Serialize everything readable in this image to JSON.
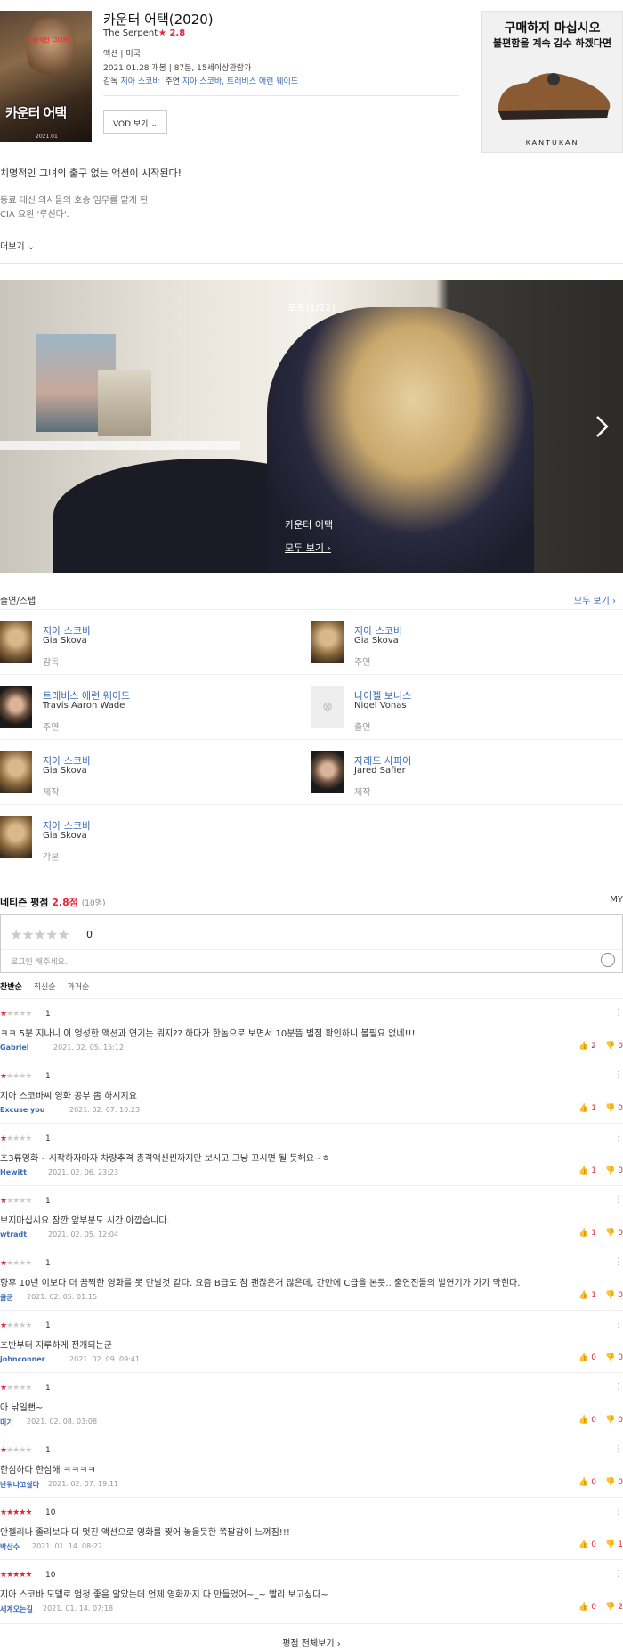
{
  "movie": {
    "title": "카운터 어택(2020)",
    "subtitle": "The Serpent",
    "rating": "★ 2.8",
    "genre": "액션  |  미국",
    "release": "2021.01.28 개봉  |  87분, 15세이상관람가",
    "director_label": "감독",
    "director": "지아 스코바",
    "cast_label": "주연",
    "cast": "지아 스코바, 트래비스 애런 웨이드",
    "vod_button": "VOD 보기",
    "poster_title": "카운터 어택",
    "poster_tag": "치명적인 그녀의",
    "poster_date": "2021.01"
  },
  "ad": {
    "line1": "구매하지 마십시오",
    "line2": "불편함을 계속 감수 하겠다면",
    "brand": "KANTUKAN"
  },
  "synopsis": {
    "tagline": "치명적인 그녀의 출구 없는 액션이 시작된다!",
    "line1": "동료 대신 의사들의 호송 임무를 맡게 된",
    "line2": "CIA 요원 '루신다'.",
    "more": "더보기"
  },
  "photo": {
    "counter": "포토(1/12)",
    "caption": "카운터 어택",
    "view_all": "모두 보기"
  },
  "castsec": {
    "title": "출연/스탭",
    "view_all": "모두 보기",
    "rows": [
      [
        {
          "name": "지아 스코바",
          "en": "Gia Skova",
          "role": "감독",
          "av": "f"
        },
        {
          "name": "지아 스코바",
          "en": "Gia Skova",
          "role": "주연",
          "av": "f"
        }
      ],
      [
        {
          "name": "트래비스 애런 웨이드",
          "en": "Travis Aaron Wade",
          "role": "주연",
          "av": "m"
        },
        {
          "name": "나이젤 보나스",
          "en": "Niqel Vonas",
          "role": "출연",
          "av": "none"
        }
      ],
      [
        {
          "name": "지아 스코바",
          "en": "Gia Skova",
          "role": "제작",
          "av": "f"
        },
        {
          "name": "자레드 사피어",
          "en": "Jared Safier",
          "role": "제작",
          "av": "m"
        }
      ],
      [
        {
          "name": "지아 스코바",
          "en": "Gia Skova",
          "role": "각본",
          "av": "f"
        }
      ]
    ]
  },
  "reviews": {
    "title": "네티즌 평점",
    "score": "2.8점",
    "count": "(10명)",
    "my": "MY",
    "zero": "0",
    "placeholder": "로그인 해주세요.",
    "tabs": [
      "찬반순",
      "최신순",
      "과거순"
    ],
    "items": [
      {
        "stars": 1,
        "score": "1",
        "text": "ㅋㅋ 5분 지나니 이 엉성한 액션과 연기는 뭐지?? 하다가 한놈으로 보면서 10분뜸 별점 확인하니 볼필요 없네!!!",
        "author": "Gabriel",
        "date": "2021. 02. 05. 15:12",
        "up": "2",
        "down": "0"
      },
      {
        "stars": 1,
        "score": "1",
        "text": "지아 스코바씨 영화 공부 좀 하시지요",
        "author": "Excuse you",
        "date": "2021. 02. 07. 10:23",
        "up": "1",
        "down": "0"
      },
      {
        "stars": 1,
        "score": "1",
        "text": "초3류영화~ 시작하자마자 차량추격 총격액션씬까지만 보시고 그냥 끄시면 될 듯해요~ㅎ",
        "author": "Hewitt",
        "date": "2021. 02. 06. 23:23",
        "up": "1",
        "down": "0"
      },
      {
        "stars": 1,
        "score": "1",
        "text": "보지마십시요.잠깐 앞부분도 시간 아깝습니다.",
        "author": "wtradt",
        "date": "2021. 02. 05. 12:04",
        "up": "1",
        "down": "0"
      },
      {
        "stars": 1,
        "score": "1",
        "text": "향후 10년 이보다 더 끔찍한 영화를 못 만날것 같다. 요즘 B급도 참 괜찮은거 많은데, 간만에 C급을 본듯.. 출연진들의 발연기가 가가 막힌다.",
        "author": "쿨군",
        "date": "2021. 02. 05. 01:15",
        "up": "1",
        "down": "0"
      },
      {
        "stars": 1,
        "score": "1",
        "text": "초반부터  지루하게 전개되는군",
        "author": "johnconner",
        "date": "2021. 02. 09. 09:41",
        "up": "0",
        "down": "0"
      },
      {
        "stars": 1,
        "score": "1",
        "text": "아 낚일뻔~",
        "author": "미기",
        "date": "2021. 02. 08. 03:08",
        "up": "0",
        "down": "0"
      },
      {
        "stars": 1,
        "score": "1",
        "text": "한심하다 한심해 ㅋㅋㅋㅋ",
        "author": "난워나고살다",
        "date": "2021. 02. 07. 19:11",
        "up": "0",
        "down": "0"
      },
      {
        "stars": 5,
        "score": "10",
        "text": "안젤리나 졸리보다 더 멋진 액션으로  영화를 찢어 놓을듯한 쪽팔감이 느껴짐!!!",
        "author": "박상수",
        "date": "2021. 01. 14. 08:22",
        "up": "0",
        "down": "1"
      },
      {
        "stars": 5,
        "score": "10",
        "text": "지아 스코바 모델로 엄청 좋음 알았는데 언제 영화까지 다 만들었어~_~ 빨리 보고싶다~",
        "author": "세계오는길",
        "date": "2021. 01. 14. 07:18",
        "up": "0",
        "down": "2"
      }
    ],
    "footer": "평점 전체보기"
  }
}
